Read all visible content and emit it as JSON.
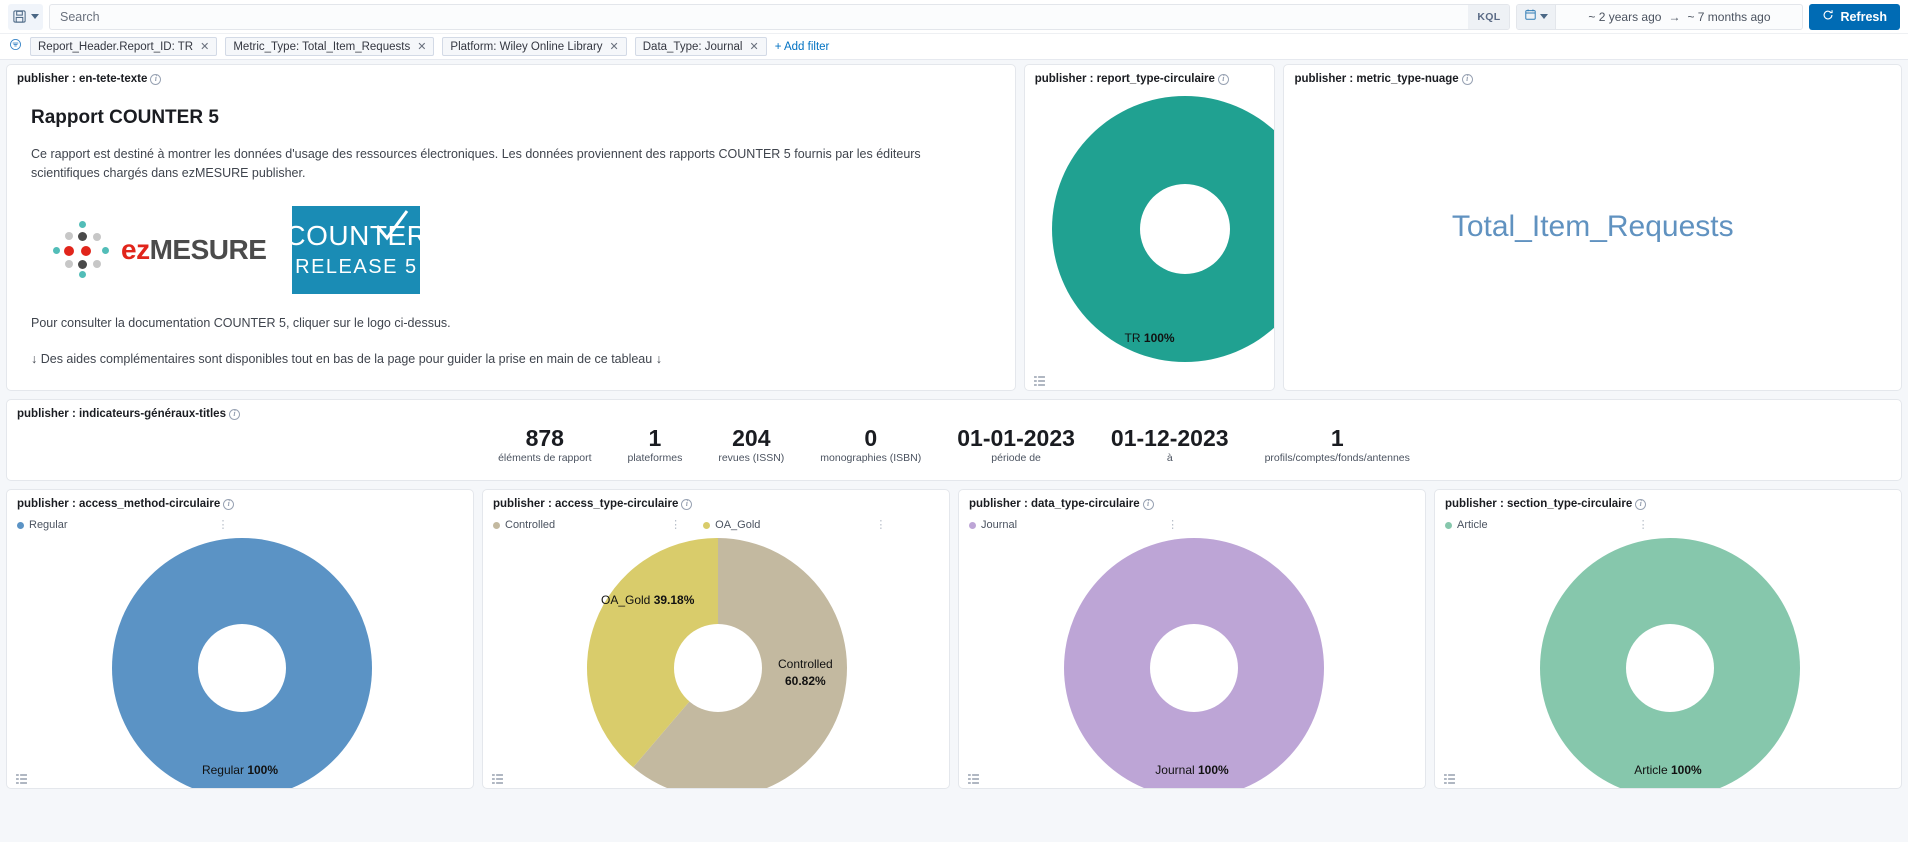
{
  "query_bar": {
    "saved_query_icon": "save-disk-icon",
    "search_placeholder": "Search",
    "search_value": "",
    "kql_label": "KQL",
    "date_icon": "calendar-icon",
    "date_from": "~ 2 years ago",
    "date_arrow": "→",
    "date_to": "~ 7 months ago",
    "refresh_label": "Refresh",
    "refresh_icon": "refresh-icon"
  },
  "filter_bar": {
    "filter_icon": "filter-icon",
    "filters": [
      {
        "label": "Report_Header.Report_ID: TR"
      },
      {
        "label": "Metric_Type: Total_Item_Requests"
      },
      {
        "label": "Platform: Wiley Online Library"
      },
      {
        "label": "Data_Type: Journal"
      }
    ],
    "add_filter_label": "+ Add filter"
  },
  "panels": {
    "markdown": {
      "title": "publisher : en-tete-texte",
      "heading": "Rapport COUNTER 5",
      "paragraph": "Ce rapport est destiné à montrer les données d'usage des ressources électroniques. Les données proviennent des rapports COUNTER 5 fournis par les éditeurs scientifiques chargés dans ezMESURE publisher.",
      "logo_ezmesure_red": "ez",
      "logo_ezmesure_gray": "MESURE",
      "logo_counter_top": "COUNTER",
      "logo_counter_bottom": "RELEASE 5",
      "note1": "Pour consulter la documentation COUNTER 5, cliquer sur le logo ci-dessus.",
      "note2": "↓ Des aides complémentaires sont disponibles tout en bas de la page pour guider la prise en main de ce tableau ↓"
    },
    "report_type": {
      "title": "publisher : report_type-circulaire"
    },
    "metric_type": {
      "title": "publisher : metric_type-nuage",
      "word": "Total_Item_Requests"
    },
    "indicateurs": {
      "title": "publisher : indicateurs-généraux-titles"
    },
    "access_method": {
      "title": "publisher : access_method-circulaire"
    },
    "access_type": {
      "title": "publisher : access_type-circulaire"
    },
    "data_type": {
      "title": "publisher : data_type-circulaire"
    },
    "section_type": {
      "title": "publisher : section_type-circulaire"
    }
  },
  "metrics": [
    {
      "value": "878",
      "label": "éléments de rapport"
    },
    {
      "value": "1",
      "label": "plateformes"
    },
    {
      "value": "204",
      "label": "revues (ISSN)"
    },
    {
      "value": "0",
      "label": "monographies (ISBN)"
    },
    {
      "value": "01-01-2023",
      "label": "période de"
    },
    {
      "value": "01-12-2023",
      "label": "à"
    },
    {
      "value": "1",
      "label": "profils/comptes/fonds/antennes"
    }
  ],
  "chart_data": [
    {
      "id": "report_type",
      "type": "pie",
      "title": "publisher : report_type-circulaire",
      "categories": [
        "TR"
      ],
      "values": [
        100
      ],
      "labels": [
        "TR 100%"
      ],
      "colors": [
        "#20a191"
      ],
      "legend": []
    },
    {
      "id": "access_method",
      "type": "pie",
      "title": "publisher : access_method-circulaire",
      "categories": [
        "Regular"
      ],
      "values": [
        100
      ],
      "labels": [
        "Regular 100%"
      ],
      "colors": [
        "#5b93c5"
      ],
      "legend": [
        "Regular"
      ]
    },
    {
      "id": "access_type",
      "type": "pie",
      "title": "publisher : access_type-circulaire",
      "categories": [
        "Controlled",
        "OA_Gold"
      ],
      "values": [
        60.82,
        39.18
      ],
      "labels": [
        "Controlled 60.82%",
        "OA_Gold 39.18%"
      ],
      "colors": [
        "#c3b9a0",
        "#d9cc6b"
      ],
      "legend": [
        "Controlled",
        "OA_Gold"
      ]
    },
    {
      "id": "data_type",
      "type": "pie",
      "title": "publisher : data_type-circulaire",
      "categories": [
        "Journal"
      ],
      "values": [
        100
      ],
      "labels": [
        "Journal 100%"
      ],
      "colors": [
        "#bda5d6"
      ],
      "legend": [
        "Journal"
      ]
    },
    {
      "id": "section_type",
      "type": "pie",
      "title": "publisher : section_type-circulaire",
      "categories": [
        "Article"
      ],
      "values": [
        100
      ],
      "labels": [
        "Article 100%"
      ],
      "colors": [
        "#86c7ac"
      ],
      "legend": [
        "Article"
      ]
    }
  ],
  "donut_labels": {
    "tr": {
      "name": "TR",
      "pct": "100%"
    },
    "regular": {
      "name": "Regular",
      "pct": "100%"
    },
    "oa_gold": {
      "name": "OA_Gold",
      "pct": "39.18%"
    },
    "controlled_name": "Controlled",
    "controlled_pct": "60.82%",
    "journal": {
      "name": "Journal",
      "pct": "100%"
    },
    "article": {
      "name": "Article",
      "pct": "100%"
    }
  },
  "legends": {
    "regular": "Regular",
    "controlled": "Controlled",
    "oa_gold": "OA_Gold",
    "journal": "Journal",
    "article": "Article"
  },
  "colors": {
    "accent": "#006bb4",
    "teal": "#20a191",
    "blue": "#5b93c5",
    "khaki": "#c3b9a0",
    "gold": "#d9cc6b",
    "purple": "#bda5d6",
    "green": "#86c7ac",
    "cloud_word": "#6092c0"
  }
}
